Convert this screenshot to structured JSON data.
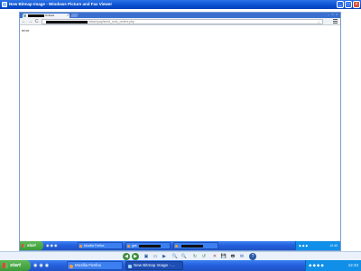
{
  "window": {
    "title": "New Bitmap Image - Windows Picture and Fax Viewer",
    "minimize_glyph": "_",
    "maximize_glyph": "□",
    "close_glyph": "×"
  },
  "browser": {
    "tab_title": "Untitled",
    "tab_close": "×",
    "window_controls": "– □ ×",
    "back_glyph": "←",
    "forward_glyph": "→",
    "reload_glyph": "C",
    "url_suffix": "urban/pay/send_sms_orders.php",
    "star_glyph": "☆",
    "page_text": "error"
  },
  "inner_taskbar": {
    "start_label": "start",
    "quick_launch": "◉◉◉",
    "task_firefox": "Mozilla Firefox",
    "task_2": "gwt",
    "tray_icons": "◆◆◆",
    "clock": "12:43"
  },
  "viewer_toolbar": {
    "buttons": [
      "◀",
      "▶",
      "▣",
      "▭",
      "🔍",
      "🔍",
      "↻",
      "↺",
      "✕",
      "💾",
      "🖶",
      "✉",
      "?"
    ]
  },
  "outer_taskbar": {
    "start_label": "start",
    "quick_launch": "◉◉◉",
    "task_firefox": "Mozilla Firefox",
    "task_viewer": "New Bitmap Image - ...",
    "tray_icons": "◆◆◆◆",
    "clock": "12:43"
  }
}
